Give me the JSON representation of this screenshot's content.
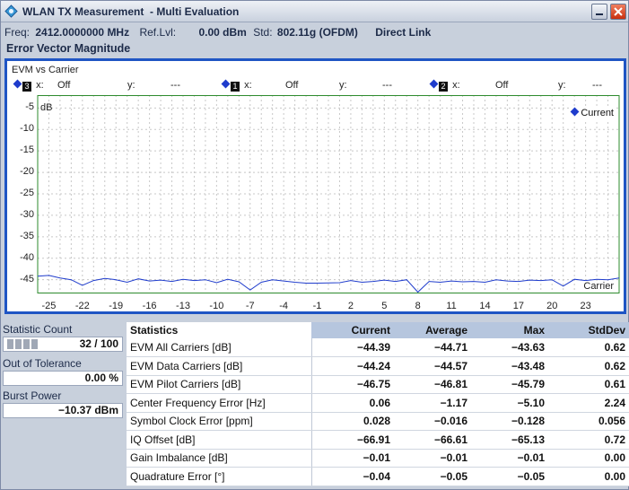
{
  "window": {
    "title": "WLAN TX Measurement  - Multi Evaluation"
  },
  "info": {
    "freq_label": "Freq:",
    "freq_value": "2412.0000000 MHz",
    "reflvl_label": "Ref.Lvl:",
    "reflvl_value": "0.00 dBm",
    "std_label": "Std:",
    "std_value": "802.11g (OFDM)",
    "link": "Direct Link"
  },
  "section_title": "Error Vector Magnitude",
  "chart": {
    "title": "EVM vs Carrier",
    "markers": [
      {
        "id": "3",
        "x_label": "x:",
        "x_value": "Off",
        "y_label": "y:",
        "y_value": "---"
      },
      {
        "id": "1",
        "x_label": "x:",
        "x_value": "Off",
        "y_label": "y:",
        "y_value": "---"
      },
      {
        "id": "2",
        "x_label": "x:",
        "x_value": "Off",
        "y_label": "y:",
        "y_value": "---"
      }
    ],
    "unit": "dB",
    "legend": "Current",
    "xlabel": "Carrier"
  },
  "chart_data": {
    "type": "line",
    "title": "EVM vs Carrier",
    "xlabel": "Carrier",
    "ylabel": "dB",
    "xlim": [
      -26,
      26
    ],
    "ylim": [
      -48,
      -2
    ],
    "x_ticks": [
      -25,
      -22,
      -19,
      -16,
      -13,
      -10,
      -7,
      -4,
      -1,
      2,
      5,
      8,
      11,
      14,
      17,
      20,
      23
    ],
    "y_ticks": [
      -5,
      -10,
      -15,
      -20,
      -25,
      -30,
      -35,
      -40,
      -45
    ],
    "grid": true,
    "legend_position": "top-right",
    "series": [
      {
        "name": "Current",
        "color": "#1f3ccc",
        "x": [
          -26,
          -25,
          -24,
          -23,
          -22,
          -21,
          -20,
          -19,
          -18,
          -17,
          -16,
          -15,
          -14,
          -13,
          -12,
          -11,
          -10,
          -9,
          -8,
          -7,
          -6,
          -5,
          -4,
          -3,
          -2,
          -1,
          1,
          2,
          3,
          4,
          5,
          6,
          7,
          8,
          9,
          10,
          11,
          12,
          13,
          14,
          15,
          16,
          17,
          18,
          19,
          20,
          21,
          22,
          23,
          24,
          25,
          26
        ],
        "y": [
          -44.2,
          -44.0,
          -44.6,
          -45.0,
          -46.3,
          -45.2,
          -44.7,
          -45.0,
          -45.6,
          -44.8,
          -45.3,
          -45.1,
          -45.4,
          -44.9,
          -45.2,
          -45.0,
          -45.7,
          -44.9,
          -45.5,
          -47.4,
          -45.6,
          -45.0,
          -45.3,
          -45.6,
          -45.8,
          -45.8,
          -45.7,
          -45.2,
          -45.6,
          -45.4,
          -45.1,
          -45.4,
          -45.0,
          -47.9,
          -45.4,
          -45.6,
          -45.3,
          -45.5,
          -45.4,
          -45.6,
          -45.0,
          -45.3,
          -45.4,
          -45.1,
          -45.2,
          -45.0,
          -46.5,
          -44.9,
          -45.2,
          -44.9,
          -45.0,
          -44.6
        ]
      }
    ]
  },
  "summary": {
    "statistic_count_label": "Statistic Count",
    "statistic_count_value": "32 / 100",
    "statistic_progress": 0.32,
    "out_of_tolerance_label": "Out of Tolerance",
    "out_of_tolerance_value": "0.00 %",
    "burst_power_label": "Burst Power",
    "burst_power_value": "−10.37 dBm"
  },
  "statistics": {
    "headers": [
      "Statistics",
      "Current",
      "Average",
      "Max",
      "StdDev"
    ],
    "rows": [
      [
        "EVM All Carriers [dB]",
        "−44.39",
        "−44.71",
        "−43.63",
        "0.62"
      ],
      [
        "EVM Data Carriers [dB]",
        "−44.24",
        "−44.57",
        "−43.48",
        "0.62"
      ],
      [
        "EVM Pilot Carriers [dB]",
        "−46.75",
        "−46.81",
        "−45.79",
        "0.61"
      ],
      [
        "Center Frequency Error [Hz]",
        "0.06",
        "−1.17",
        "−5.10",
        "2.24"
      ],
      [
        "Symbol Clock Error [ppm]",
        "0.028",
        "−0.016",
        "−0.128",
        "0.056"
      ],
      [
        "IQ Offset [dB]",
        "−66.91",
        "−66.61",
        "−65.13",
        "0.72"
      ],
      [
        "Gain Imbalance [dB]",
        "−0.01",
        "−0.01",
        "−0.01",
        "0.00"
      ],
      [
        "Quadrature Error [°]",
        "−0.04",
        "−0.05",
        "−0.05",
        "0.00"
      ]
    ]
  }
}
